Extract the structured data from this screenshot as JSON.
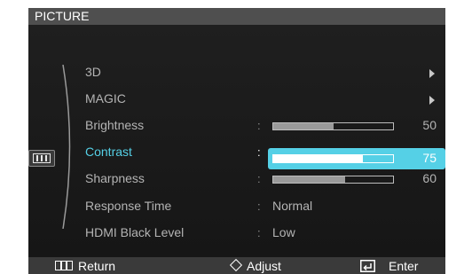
{
  "window": {
    "title": "PICTURE"
  },
  "menu": {
    "items": [
      {
        "label": "3D",
        "has_submenu": true
      },
      {
        "label": "MAGIC",
        "has_submenu": true
      },
      {
        "label": "Brightness",
        "value": 50,
        "max": 100
      },
      {
        "label": "Contrast",
        "value": 75,
        "max": 100,
        "selected": true
      },
      {
        "label": "Sharpness",
        "value": 60,
        "max": 100
      },
      {
        "label": "Response Time",
        "value": "Normal"
      },
      {
        "label": "HDMI Black Level",
        "value": "Low"
      }
    ],
    "colon": ":"
  },
  "footer": {
    "return_label": "Return",
    "adjust_label": "Adjust",
    "enter_label": "Enter"
  },
  "colors": {
    "accent": "#55d0e6",
    "background": "#1c1c1c",
    "title_bar": "#4f4f4f"
  },
  "icons": {
    "category": "picture-icon",
    "submenu": "triangle-right-icon",
    "return": "return-icon",
    "adjust": "diamond-icon",
    "enter": "enter-icon"
  }
}
